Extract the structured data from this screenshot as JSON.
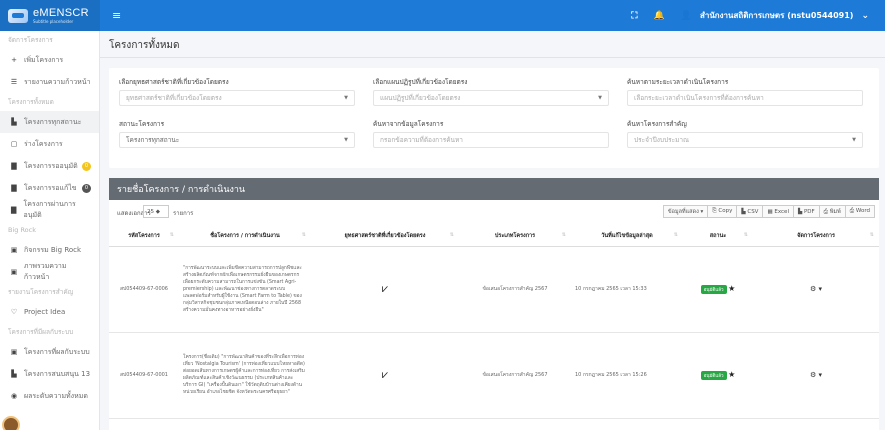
{
  "app": {
    "name": "eMENSCR",
    "subtitle": "Subtitle placeholder",
    "user": "สำนักงานสถิติการเกษตร (nstu0544091)"
  },
  "sidebar": {
    "items": [
      {
        "kind": "head",
        "label": "จัดการโครงการ"
      },
      {
        "kind": "item",
        "icon": "+",
        "label": "เพิ่มโครงการ"
      },
      {
        "kind": "item",
        "icon": "☰",
        "label": "รายงานความก้าวหน้า"
      },
      {
        "kind": "head",
        "label": "โครงการทั้งหมด"
      },
      {
        "kind": "item",
        "icon": "▙",
        "label": "โครงการทุกสถานะ",
        "active": true
      },
      {
        "kind": "item",
        "icon": "▢",
        "label": "ร่างโครงการ"
      },
      {
        "kind": "item",
        "icon": "▇",
        "label": "โครงการรออนุมัติ",
        "badge": "0",
        "badge_style": "yellow"
      },
      {
        "kind": "item",
        "icon": "▇",
        "label": "โครงการรอแก้ไข",
        "badge": "0",
        "badge_style": "dark"
      },
      {
        "kind": "item",
        "icon": "▇",
        "label": "โครงการผ่านการอนุมัติ"
      },
      {
        "kind": "head",
        "label": "Big Rock"
      },
      {
        "kind": "item",
        "icon": "▣",
        "label": "กิจกรรม Big Rock"
      },
      {
        "kind": "item",
        "icon": "▣",
        "label": "ภาพรวมความก้าวหน้า"
      },
      {
        "kind": "head",
        "label": "รายงานโครงการสำคัญ"
      },
      {
        "kind": "item",
        "icon": "♡",
        "label": "Project Idea"
      },
      {
        "kind": "head",
        "label": "โครงการที่มีผลกับระบบ"
      },
      {
        "kind": "item",
        "icon": "▣",
        "label": "โครงการที่ผลกับระบบ"
      },
      {
        "kind": "item",
        "icon": "▙",
        "label": "โครงการสนบสนุน 13"
      },
      {
        "kind": "item",
        "icon": "◉",
        "label": "ผลระดับความทั้งหมด"
      }
    ]
  },
  "page": {
    "title": "โครงการทั้งหมด"
  },
  "filters": {
    "f1": {
      "label": "เลือกยุทธศาสตร์ชาติที่เกี่ยวข้องโดยตรง",
      "placeholder": "ยุทธศาสตร์ชาติที่เกี่ยวข้องโดยตรง"
    },
    "f2": {
      "label": "เลือกแผนปฏิรูปที่เกี่ยวข้องโดยตรง",
      "placeholder": "แผนปฏิรูปที่เกี่ยวข้องโดยตรง"
    },
    "f3": {
      "label": "ค้นหาตามระยะเวลาดำเนินโครงการ",
      "placeholder": "เลือกระยะเวลาดำเนินโครงการที่ต้องการค้นหา"
    },
    "f4": {
      "label": "สถานะโครงการ",
      "value": "โครงการทุกสถานะ"
    },
    "f5": {
      "label": "ค้นหาจากข้อมูลโครงการ",
      "placeholder": "กรอกข้อความที่ต้องการค้นหา"
    },
    "f6": {
      "label": "ค้นหาโครงการสำคัญ",
      "placeholder": "ประจำปีงบประมาณ"
    }
  },
  "list": {
    "title": "รายชื่อโครงการ / การดำเนินงาน",
    "show_label": "แสดงเอกสาร",
    "page_size": "25",
    "show_suffix": "รายการ",
    "buttons": [
      "ข้อมูลที่แสดง ▾",
      "⎘ Copy",
      "▙ CSV",
      "▦ Excel",
      "▙ PDF",
      "⎙ พิมพ์",
      "⎙ Word"
    ],
    "columns": [
      "รหัสโครงการ",
      "ชื่อโครงการ / การดำเนินงาน",
      "ยุทธศาสตร์ชาติที่เกี่ยวข้องโดยตรง",
      "ประเภทโครงการ",
      "วันที่แก้ไขข้อมูลล่าสุด",
      "สถานะ",
      "จัดการโครงการ"
    ],
    "rows": [
      {
        "code": "สป054409-67-0006",
        "name": "\"การพัฒนาระบบและเพิ่มขีดความสามารถการปลูกพืชและสร้างผลิตภัณฑ์จากผักเพื่อเกษตรกรรมยั่งยืนของเกษตรกร เพื่อยกระดับความสามารถในการแข่งขัน (Smart Agri-premiership) และพัฒนาช่องทางการตลาดระบบแพลตฟอร์มสำหรับผู้ใช้งาน (Smart Farm to Table) ของกลุ่มวิสาหกิจชุมชนกลุ่มภาคเหนือตอนล่าง ภายในปี 2568 สร้างความมั่นคงทางอาหารอย่างยั่งยืน\"",
        "type": "ข้อเสนอโครงการสำคัญ 2567",
        "updated": "10 กรกฎาคม 2565 เวลา 15:33",
        "status": "อนุมัติแล้ว"
      },
      {
        "code": "สป054409-67-0001",
        "name": "โครงการ(ชื่อเดิม) \"การพัฒนาสินค้าของที่ระลึกเพื่อการท่องเที่ยว 'Nostalgia Tourism' (การท่องเที่ยวแบบโหยหาอดีต) ต่อยอดเส้นทางการเกษตรผู้ค้าและการท่องเที่ยว การส่งเสริมผลิตภัณฑ์และสินค้าเชิงวัฒนธรรม (ประเภทสินค้าและบริการ GI) \"เครื่องปั้นดินเผา\" ใช้วัตถุดิบบ้านต่างเคียงด้านหน่วยเรียน อำเภอไชยชิต จังหวัดพระนครศรีอยุธยา\"",
        "type": "ข้อเสนอโครงการสำคัญ 2567",
        "updated": "10 กรกฎาคม 2565 เวลา 15:26",
        "status": "อนุมัติแล้ว"
      }
    ]
  },
  "colors": {
    "topbar": "#1d7ad6",
    "list_header": "#646b73",
    "status_green": "#27a844"
  }
}
